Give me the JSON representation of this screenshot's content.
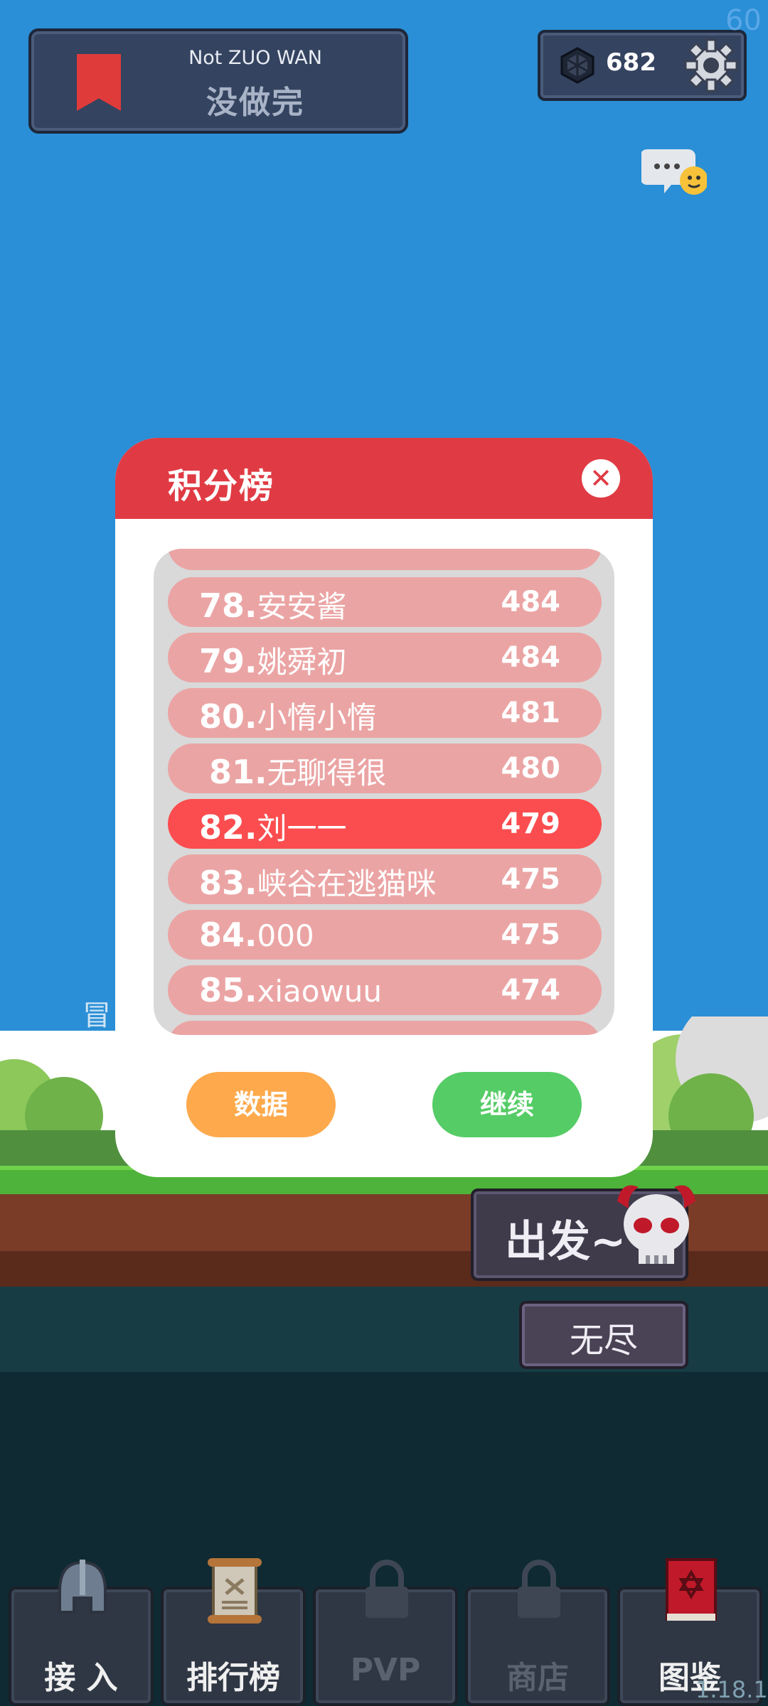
{
  "hud": {
    "fps": "60",
    "version": "1.18.1",
    "quest_en": "Not ZUO WAN",
    "quest_cn": "没做完",
    "gem_count": "682"
  },
  "scoreboard": {
    "title": "积分榜",
    "close_icon": "close-icon",
    "rows": [
      {
        "rank": "78",
        "name": "安安酱",
        "score": "484",
        "highlight": false
      },
      {
        "rank": "79",
        "name": "姚舜初",
        "score": "484",
        "highlight": false
      },
      {
        "rank": "80",
        "name": "小惰小惰",
        "score": "481",
        "highlight": false
      },
      {
        "rank": "81",
        "name": "无聊得很",
        "score": "480",
        "highlight": false
      },
      {
        "rank": "82",
        "name": "刘一一",
        "score": "479",
        "highlight": true
      },
      {
        "rank": "83",
        "name": "峡谷在逃猫咪",
        "score": "475",
        "highlight": false
      },
      {
        "rank": "84",
        "name": "000",
        "score": "475",
        "highlight": false
      },
      {
        "rank": "85",
        "name": "xiaowuu",
        "score": "474",
        "highlight": false
      }
    ],
    "data_button": "数据",
    "continue_button": "继续"
  },
  "game": {
    "char_label": "冒",
    "go_button": "出发~",
    "endless_button": "无尽"
  },
  "nav": [
    {
      "label": "接 入",
      "icon": "helmet-icon",
      "locked": false
    },
    {
      "label": "排行榜",
      "icon": "scroll-icon",
      "locked": false
    },
    {
      "label": "PVP",
      "icon": "lock-icon",
      "locked": true
    },
    {
      "label": "商店",
      "icon": "lock-icon",
      "locked": true
    },
    {
      "label": "图鉴",
      "icon": "book-icon",
      "locked": false
    }
  ],
  "colors": {
    "sky": "#2a8fd6",
    "header_red": "#e03b44",
    "row_pink": "#eba4a4",
    "row_highlight": "#fb4d4f",
    "data_orange": "#fda94c",
    "continue_green": "#55cc66"
  }
}
